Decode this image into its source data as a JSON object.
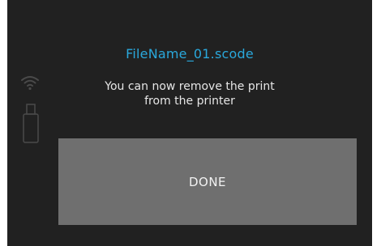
{
  "screen": {
    "filename": "FileName_01.scode",
    "message_line1": "You can now remove the print",
    "message_line2": "from the printer",
    "done_label": "DONE"
  },
  "status_icons": {
    "wifi": "wifi-icon",
    "usb": "usb-drive-icon"
  },
  "colors": {
    "background": "#212121",
    "filename": "#2aa8dc",
    "text": "#e6e6e6",
    "button": "#6f6f6f",
    "icon": "#4a4a4a"
  }
}
